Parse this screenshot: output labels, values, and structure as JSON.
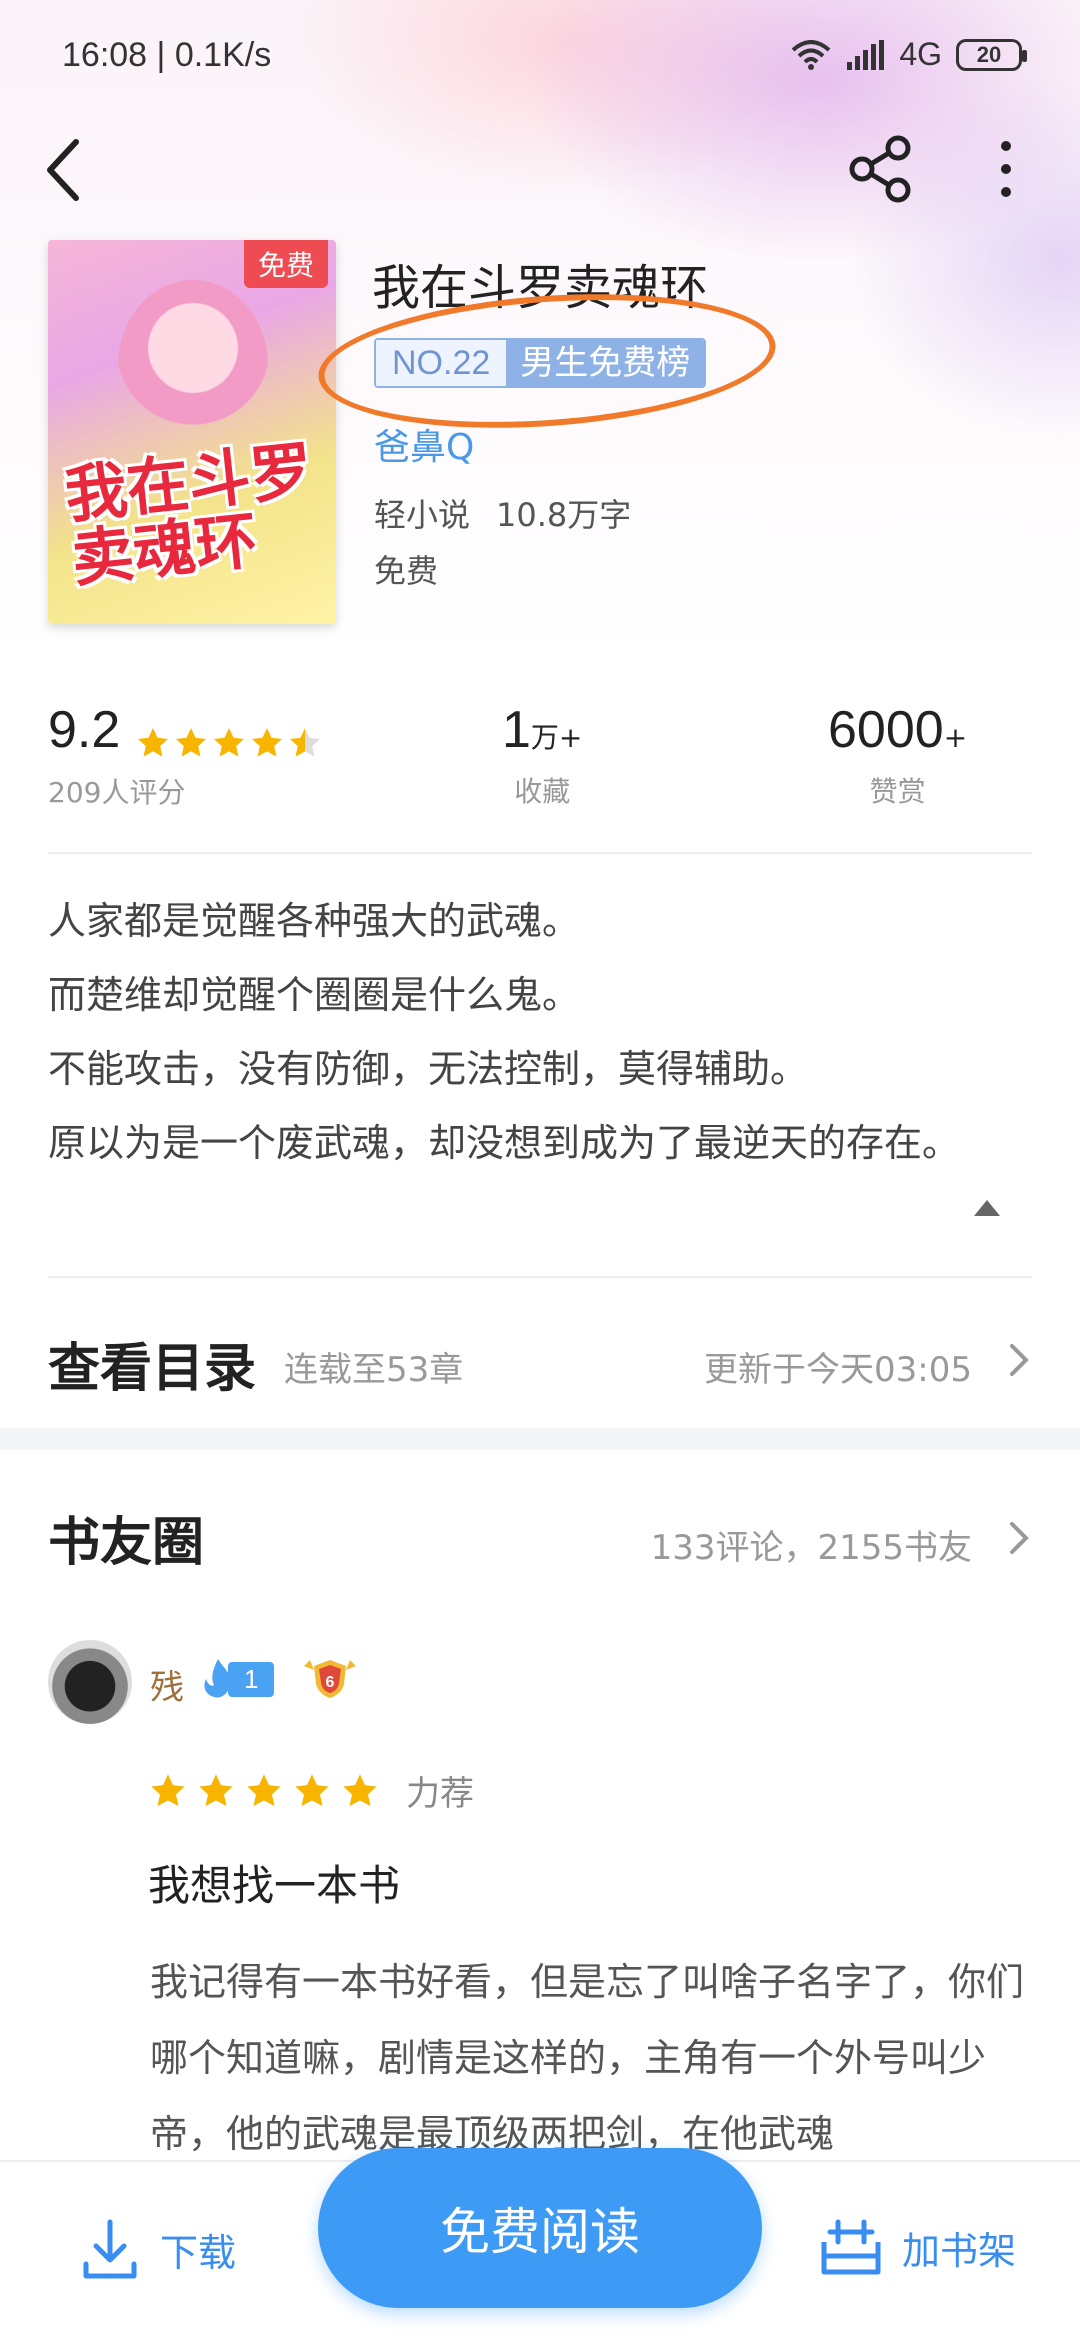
{
  "status_bar": {
    "time": "16:08",
    "speed": "0.1K/s",
    "network": "4G",
    "battery": "20"
  },
  "book": {
    "cover_badge": "免费",
    "cover_title": "我在斗罗卖魂环",
    "title": "我在斗罗卖魂环",
    "rank_no": "NO.22",
    "rank_list": "男生免费榜",
    "author": "爸鼻Q",
    "category": "轻小说",
    "word_count": "10.8万字",
    "price": "免费"
  },
  "stats": {
    "rating": "9.2",
    "rating_stars": 4.5,
    "rating_count": "209人评分",
    "collect_value": "1",
    "collect_unit": "万+",
    "collect_label": "收藏",
    "reward_value": "6000",
    "reward_unit": "+",
    "reward_label": "赞赏"
  },
  "intro": {
    "lines": [
      "人家都是觉醒各种强大的武魂。",
      "而楚维却觉醒个圈圈是什么鬼。",
      "不能攻击，没有防御，无法控制，莫得辅助。",
      "原以为是一个废武魂，却没想到成为了最逆天的存在。"
    ]
  },
  "catalog": {
    "title": "查看目录",
    "status": "连载至53章",
    "update": "更新于今天03:05"
  },
  "circle": {
    "title": "书友圈",
    "stats": "133评论，2155书友",
    "review": {
      "username": "残",
      "fan_level": "1",
      "badge_level": "6",
      "stars": 5,
      "tag": "力荐",
      "title": "我想找一本书",
      "body": "我记得有一本书好看，但是忘了叫啥子名字了，你们哪个知道嘛，剧情是这样的，主角有一个外号叫少帝，他的武魂是最顶级两把剑，在他武魂"
    }
  },
  "bottom_bar": {
    "download": "下载",
    "read": "免费阅读",
    "shelf": "加书架"
  },
  "colors": {
    "accent": "#3d9bf5",
    "star": "#f7b500",
    "highlight": "#f07a2a"
  }
}
